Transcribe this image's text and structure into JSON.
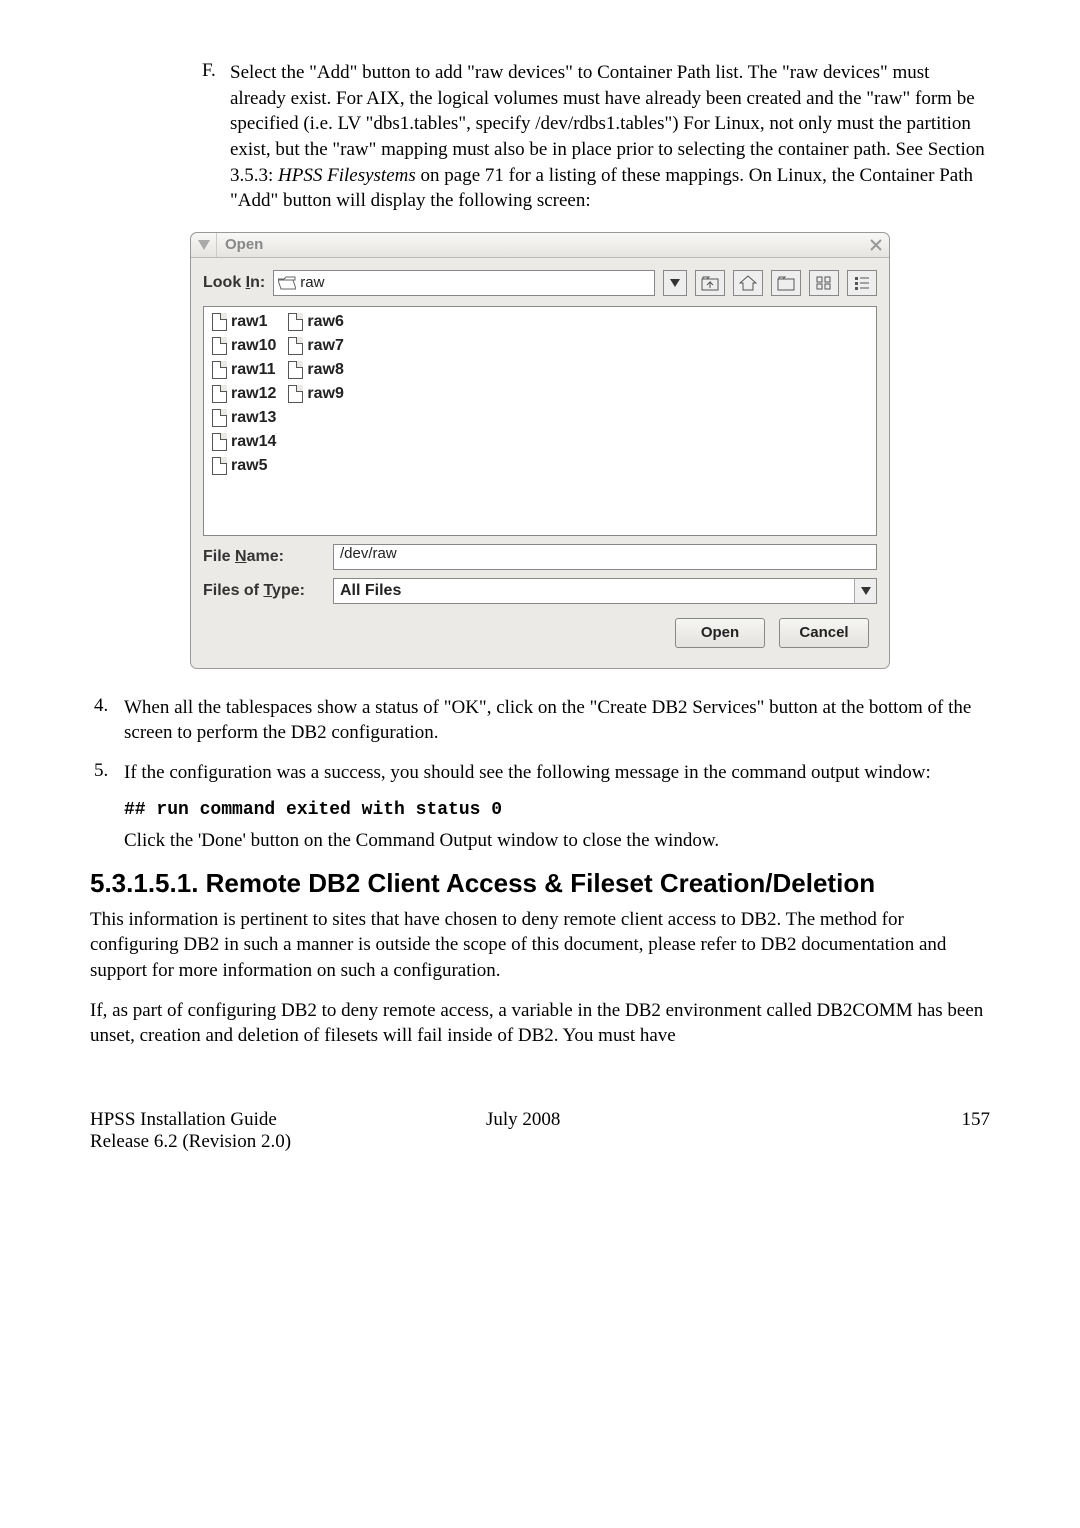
{
  "listF": {
    "letter": "F.",
    "text_pre": "Select the \"Add\" button to add \"raw devices\" to Container Path list.  The \"raw devices\" must already exist.  For AIX, the logical volumes must have already been created and the \"raw\" form be specified (i.e. LV \"dbs1.tables\", specify /dev/rdbs1.tables\")  For Linux, not only must the partition exist, but the \"raw\" mapping must also be in place prior to selecting the container path.  See Section     3.5.3: ",
    "text_italic": "HPSS Filesystems",
    "text_post": " on page 71 for a listing of these mappings.  On Linux, the Container Path \"Add\" button will display the following screen:"
  },
  "dialog": {
    "title": "Open",
    "lookin_label_pre": "Look ",
    "lookin_label_key": "I",
    "lookin_label_post": "n:",
    "lookin_value": "raw",
    "files_col1": [
      "raw1",
      "raw10",
      "raw11",
      "raw12",
      "raw13",
      "raw14",
      "raw5"
    ],
    "files_col2": [
      "raw6",
      "raw7",
      "raw8",
      "raw9"
    ],
    "filename_label_pre": "File ",
    "filename_label_key": "N",
    "filename_label_post": "ame:",
    "filename_value": "/dev/raw",
    "filetype_label_pre": "Files of ",
    "filetype_label_key": "T",
    "filetype_label_post": "ype:",
    "filetype_value": "All Files",
    "open_btn": "Open",
    "cancel_btn": "Cancel"
  },
  "item4": {
    "num": "4.",
    "text": "When all the tablespaces show a status of \"OK\", click on the \"Create DB2 Services\" button at the bottom of the screen to perform the DB2 configuration."
  },
  "item5": {
    "num": "5.",
    "text": "If the configuration was a success, you should see the following message in the command output window:",
    "code": "## run command exited with status 0",
    "after": "Click the 'Done' button on the Command Output window to close the window."
  },
  "section_heading": "5.3.1.5.1.  Remote DB2 Client Access & Fileset Creation/Deletion",
  "para1": "This information is pertinent to sites that have chosen to deny remote client access to DB2.  The method for configuring DB2 in such a manner is outside the scope of this document, please refer to DB2 documentation and support for more information on such a configuration.",
  "para2": "If, as part of configuring DB2 to deny remote access, a variable in the DB2 environment called DB2COMM has been unset, creation and deletion of filesets will fail inside of DB2.  You must have",
  "footer": {
    "left1": "HPSS Installation Guide",
    "left2": "Release 6.2 (Revision 2.0)",
    "center": "July 2008",
    "right": "157"
  }
}
